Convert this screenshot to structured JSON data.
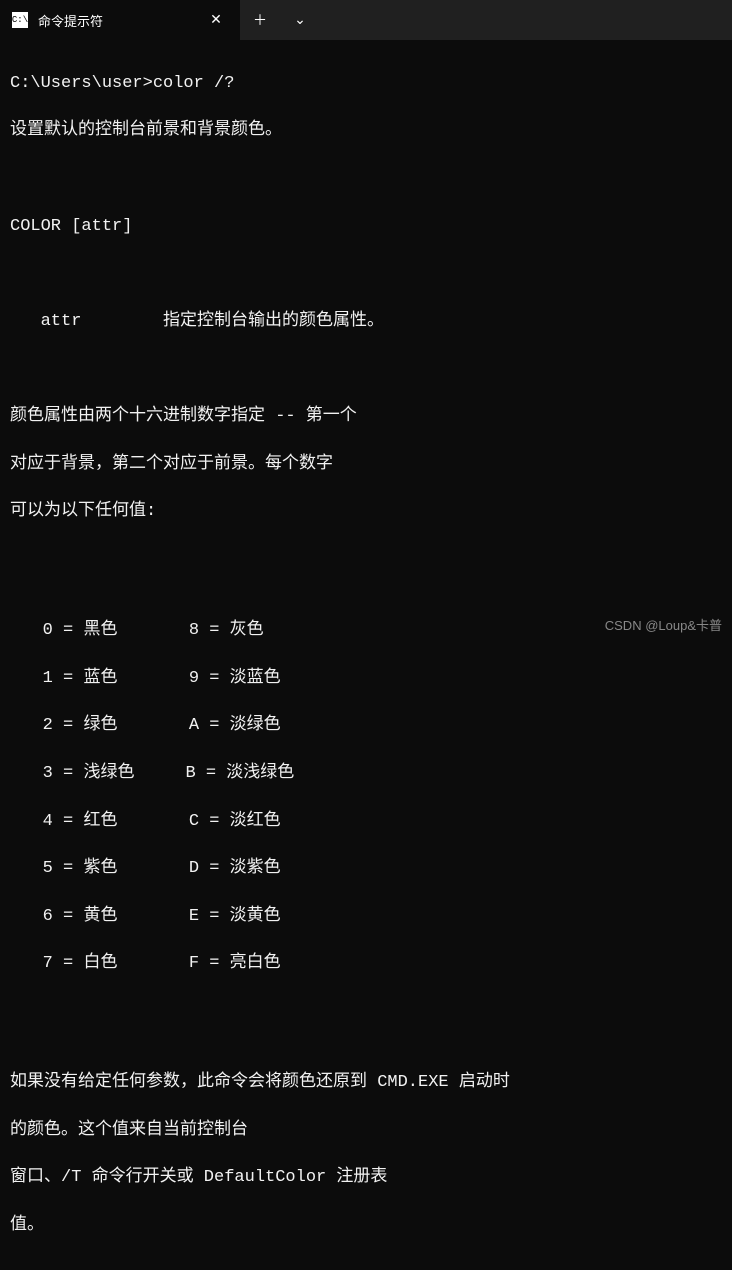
{
  "titlebar": {
    "tab_title": "命令提示符",
    "close_glyph": "✕",
    "new_tab_glyph": "＋",
    "dropdown_glyph": "⌄"
  },
  "terminal": {
    "prompt": "C:\\Users\\user>",
    "command": "color /?",
    "line_desc": "设置默认的控制台前景和背景颜色。",
    "syntax": "COLOR [attr]",
    "attr_label": "   attr",
    "attr_desc": "        指定控制台输出的颜色属性。",
    "para2_l1": "颜色属性由两个十六进制数字指定 -- 第一个",
    "para2_l2": "对应于背景，第二个对应于前景。每个数字",
    "para2_l3": "可以为以下任何值:",
    "colors": {
      "r0": "0 = 黑色       8 = 灰色",
      "r1": "1 = 蓝色       9 = 淡蓝色",
      "r2": "2 = 绿色       A = 淡绿色",
      "r3": "3 = 浅绿色     B = 淡浅绿色",
      "r4": "4 = 红色       C = 淡红色",
      "r5": "5 = 紫色       D = 淡紫色",
      "r6": "6 = 黄色       E = 淡黄色",
      "r7": "7 = 白色       F = 亮白色"
    },
    "para3_l1": "如果没有给定任何参数，此命令会将颜色还原到 CMD.EXE 启动时",
    "para3_l2": "的颜色。这个值来自当前控制台",
    "para3_l3": "窗口、/T 命令行开关或 DefaultColor 注册表",
    "para3_l4": "值。"
  },
  "watermark": "CSDN @Loup&卡普"
}
